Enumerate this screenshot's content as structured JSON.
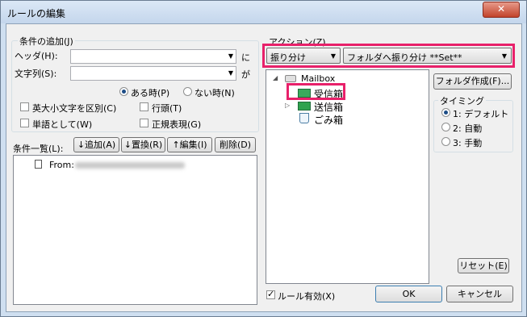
{
  "window": {
    "title": "ルールの編集",
    "close_glyph": "✕"
  },
  "condition_add": {
    "group_label": "条件の追加(J)",
    "header_label": "ヘッダ(H):",
    "header_suffix": "に",
    "string_label": "文字列(S):",
    "string_suffix": "が",
    "radio_present": "ある時(P)",
    "radio_absent": "ない時(N)",
    "check_case": "英大小文字を区別(C)",
    "check_linehead": "行頭(T)",
    "check_word": "単語として(W)",
    "check_regex": "正規表現(G)"
  },
  "condition_list": {
    "label": "条件一覧(L):",
    "add_button": "↓追加(A)",
    "replace_button": "↓置換(R)",
    "edit_button": "↑編集(I)",
    "delete_button": "削除(D)",
    "item_prefix": "From:"
  },
  "action": {
    "group_label": "アクション(Z)",
    "action_combo": "振り分け",
    "target_combo": "フォルダへ振り分け **Set**",
    "create_folder_button": "フォルダ作成(F)..."
  },
  "folders": {
    "root": "Mailbox",
    "items": [
      "受信箱",
      "送信箱",
      "ごみ箱"
    ]
  },
  "timing": {
    "group_label": "タイミング",
    "options": [
      "1: デフォルト",
      "2: 自動",
      "3: 手動"
    ]
  },
  "footer": {
    "reset_button": "リセット(E)",
    "enable_rule": "ルール有効(X)",
    "ok_button": "OK",
    "cancel_button": "キャンセル"
  },
  "colors": {
    "highlight": "#e8206a",
    "title_bg": "#cfdff0"
  }
}
